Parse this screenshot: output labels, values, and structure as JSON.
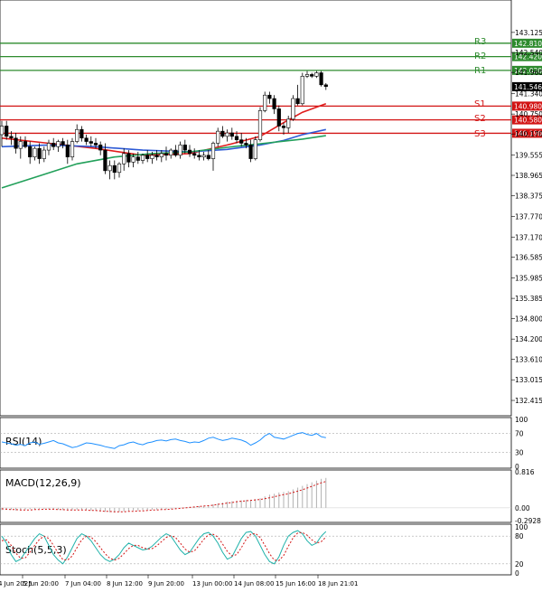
{
  "chart_data": {
    "type": "candlestick",
    "price_axis": {
      "range": [
        132.1,
        143.7
      ],
      "tick_labels": [
        "143.125",
        "142.540",
        "141.960",
        "141.340",
        "140.750",
        "140.170",
        "139.555",
        "138.965",
        "138.375",
        "137.770",
        "137.170",
        "136.585",
        "135.985",
        "135.385",
        "134.800",
        "134.200",
        "133.610",
        "133.015",
        "132.415"
      ],
      "current_price": "141.546"
    },
    "time_axis": {
      "tick_labels": [
        "4 Jun 2025",
        "5 Jun 20:00",
        "7 Jun 04:00",
        "8 Jun 12:00",
        "9 Jun 20:00",
        "13 Jun 00:00",
        "14 Jun 08:00",
        "15 Jun 16:00",
        "18 Jun 21:01"
      ]
    },
    "levels": [
      {
        "name": "",
        "value": 142.81,
        "label": "142.810",
        "color": "#2e8b2e"
      },
      {
        "name": "R3",
        "value": 142.42,
        "label": "142.420",
        "color": "#2e8b2e"
      },
      {
        "name": "R2",
        "value": 142.02,
        "label": "142.020",
        "color": "#2e8b2e"
      },
      {
        "name": "R1",
        "value": null,
        "label": "",
        "color": "#2e8b2e"
      },
      {
        "name": "S1",
        "value": 140.98,
        "label": "140.980",
        "color": "#d21414"
      },
      {
        "name": "S2",
        "value": 140.58,
        "label": "140.580",
        "color": "#d21414"
      },
      {
        "name": "S3",
        "value": 140.19,
        "label": "140.190",
        "color": "#d21414"
      }
    ],
    "candles": [
      {
        "o": 140.15,
        "h": 140.55,
        "l": 139.8,
        "c": 140.4
      },
      {
        "o": 140.4,
        "h": 140.55,
        "l": 140.0,
        "c": 140.1
      },
      {
        "o": 140.1,
        "h": 140.25,
        "l": 139.85,
        "c": 140.05
      },
      {
        "o": 140.05,
        "h": 140.2,
        "l": 139.6,
        "c": 139.75
      },
      {
        "o": 139.75,
        "h": 140.1,
        "l": 139.45,
        "c": 139.95
      },
      {
        "o": 139.95,
        "h": 140.1,
        "l": 139.75,
        "c": 139.8
      },
      {
        "o": 139.8,
        "h": 139.95,
        "l": 139.3,
        "c": 139.5
      },
      {
        "o": 139.5,
        "h": 139.8,
        "l": 139.4,
        "c": 139.75
      },
      {
        "o": 139.75,
        "h": 139.9,
        "l": 139.3,
        "c": 139.45
      },
      {
        "o": 139.45,
        "h": 139.8,
        "l": 139.35,
        "c": 139.7
      },
      {
        "o": 139.7,
        "h": 140.0,
        "l": 139.55,
        "c": 139.9
      },
      {
        "o": 139.9,
        "h": 140.05,
        "l": 139.7,
        "c": 139.8
      },
      {
        "o": 139.8,
        "h": 140.0,
        "l": 139.65,
        "c": 139.95
      },
      {
        "o": 139.95,
        "h": 140.05,
        "l": 139.75,
        "c": 139.85
      },
      {
        "o": 139.85,
        "h": 140.0,
        "l": 139.3,
        "c": 139.5
      },
      {
        "o": 139.5,
        "h": 140.05,
        "l": 139.4,
        "c": 139.95
      },
      {
        "o": 139.95,
        "h": 140.45,
        "l": 139.9,
        "c": 140.3
      },
      {
        "o": 140.3,
        "h": 140.4,
        "l": 139.95,
        "c": 140.05
      },
      {
        "o": 140.05,
        "h": 140.15,
        "l": 139.85,
        "c": 139.95
      },
      {
        "o": 139.95,
        "h": 140.1,
        "l": 139.8,
        "c": 139.9
      },
      {
        "o": 139.9,
        "h": 140.05,
        "l": 139.75,
        "c": 139.85
      },
      {
        "o": 139.85,
        "h": 139.95,
        "l": 139.55,
        "c": 139.7
      },
      {
        "o": 139.7,
        "h": 139.9,
        "l": 139.0,
        "c": 139.1
      },
      {
        "o": 139.1,
        "h": 139.4,
        "l": 138.85,
        "c": 139.25
      },
      {
        "o": 139.25,
        "h": 139.4,
        "l": 138.85,
        "c": 139.05
      },
      {
        "o": 139.05,
        "h": 139.35,
        "l": 138.9,
        "c": 139.3
      },
      {
        "o": 139.3,
        "h": 139.75,
        "l": 139.1,
        "c": 139.6
      },
      {
        "o": 139.6,
        "h": 139.7,
        "l": 139.2,
        "c": 139.35
      },
      {
        "o": 139.35,
        "h": 139.6,
        "l": 139.2,
        "c": 139.5
      },
      {
        "o": 139.5,
        "h": 139.65,
        "l": 139.3,
        "c": 139.4
      },
      {
        "o": 139.4,
        "h": 139.6,
        "l": 139.3,
        "c": 139.55
      },
      {
        "o": 139.55,
        "h": 139.7,
        "l": 139.35,
        "c": 139.45
      },
      {
        "o": 139.45,
        "h": 139.65,
        "l": 139.3,
        "c": 139.55
      },
      {
        "o": 139.55,
        "h": 139.7,
        "l": 139.4,
        "c": 139.5
      },
      {
        "o": 139.5,
        "h": 139.7,
        "l": 139.35,
        "c": 139.6
      },
      {
        "o": 139.6,
        "h": 139.8,
        "l": 139.4,
        "c": 139.55
      },
      {
        "o": 139.55,
        "h": 139.75,
        "l": 139.45,
        "c": 139.7
      },
      {
        "o": 139.7,
        "h": 139.85,
        "l": 139.5,
        "c": 139.55
      },
      {
        "o": 139.55,
        "h": 139.95,
        "l": 139.45,
        "c": 139.85
      },
      {
        "o": 139.85,
        "h": 140.0,
        "l": 139.6,
        "c": 139.7
      },
      {
        "o": 139.7,
        "h": 139.85,
        "l": 139.5,
        "c": 139.6
      },
      {
        "o": 139.6,
        "h": 139.75,
        "l": 139.45,
        "c": 139.55
      },
      {
        "o": 139.55,
        "h": 139.7,
        "l": 139.4,
        "c": 139.5
      },
      {
        "o": 139.5,
        "h": 139.65,
        "l": 139.4,
        "c": 139.55
      },
      {
        "o": 139.55,
        "h": 139.7,
        "l": 139.4,
        "c": 139.45
      },
      {
        "o": 139.45,
        "h": 139.95,
        "l": 139.1,
        "c": 139.9
      },
      {
        "o": 139.9,
        "h": 140.35,
        "l": 139.8,
        "c": 140.25
      },
      {
        "o": 140.25,
        "h": 140.4,
        "l": 140.05,
        "c": 140.1
      },
      {
        "o": 140.1,
        "h": 140.3,
        "l": 139.95,
        "c": 140.2
      },
      {
        "o": 140.2,
        "h": 140.35,
        "l": 140.0,
        "c": 140.1
      },
      {
        "o": 140.1,
        "h": 140.25,
        "l": 139.9,
        "c": 140.0
      },
      {
        "o": 140.0,
        "h": 140.2,
        "l": 139.8,
        "c": 139.9
      },
      {
        "o": 139.9,
        "h": 140.05,
        "l": 139.75,
        "c": 139.85
      },
      {
        "o": 139.85,
        "h": 140.0,
        "l": 139.35,
        "c": 139.45
      },
      {
        "o": 139.45,
        "h": 140.1,
        "l": 139.4,
        "c": 140.0
      },
      {
        "o": 140.0,
        "h": 140.95,
        "l": 139.95,
        "c": 140.85
      },
      {
        "o": 140.85,
        "h": 141.4,
        "l": 140.8,
        "c": 141.3
      },
      {
        "o": 141.3,
        "h": 141.4,
        "l": 141.05,
        "c": 141.2
      },
      {
        "o": 141.2,
        "h": 141.3,
        "l": 140.75,
        "c": 140.9
      },
      {
        "o": 140.9,
        "h": 141.0,
        "l": 140.25,
        "c": 140.4
      },
      {
        "o": 140.4,
        "h": 140.5,
        "l": 140.15,
        "c": 140.35
      },
      {
        "o": 140.35,
        "h": 140.7,
        "l": 140.2,
        "c": 140.6
      },
      {
        "o": 140.6,
        "h": 141.3,
        "l": 140.55,
        "c": 141.2
      },
      {
        "o": 141.2,
        "h": 141.6,
        "l": 141.0,
        "c": 141.05
      },
      {
        "o": 141.05,
        "h": 141.95,
        "l": 141.0,
        "c": 141.85
      },
      {
        "o": 141.85,
        "h": 142.0,
        "l": 141.8,
        "c": 141.9
      },
      {
        "o": 141.9,
        "h": 141.95,
        "l": 141.8,
        "c": 141.85
      },
      {
        "o": 141.85,
        "h": 142.0,
        "l": 141.8,
        "c": 141.95
      },
      {
        "o": 141.95,
        "h": 142.0,
        "l": 141.55,
        "c": 141.6
      },
      {
        "o": 141.6,
        "h": 141.65,
        "l": 141.45,
        "c": 141.55
      }
    ],
    "moving_averages": [
      {
        "color": "#e01c1c",
        "values": [
          [
            0,
            140.05
          ],
          [
            10,
            139.9
          ],
          [
            20,
            139.75
          ],
          [
            30,
            139.55
          ],
          [
            40,
            139.6
          ],
          [
            48,
            139.85
          ],
          [
            55,
            140.1
          ],
          [
            60,
            140.5
          ],
          [
            64,
            140.8
          ],
          [
            69,
            141.05
          ]
        ]
      },
      {
        "color": "#2e5bd6",
        "values": [
          [
            0,
            139.8
          ],
          [
            10,
            139.85
          ],
          [
            20,
            139.8
          ],
          [
            30,
            139.7
          ],
          [
            40,
            139.65
          ],
          [
            48,
            139.72
          ],
          [
            55,
            139.85
          ],
          [
            60,
            139.98
          ],
          [
            64,
            140.15
          ],
          [
            69,
            140.3
          ]
        ]
      },
      {
        "color": "#22a05a",
        "values": [
          [
            0,
            138.6
          ],
          [
            8,
            138.95
          ],
          [
            16,
            139.3
          ],
          [
            24,
            139.5
          ],
          [
            32,
            139.6
          ],
          [
            40,
            139.65
          ],
          [
            48,
            139.78
          ],
          [
            56,
            139.9
          ],
          [
            64,
            140.02
          ],
          [
            69,
            140.12
          ]
        ]
      }
    ],
    "rsi": {
      "name": "RSI(14)",
      "range": [
        0,
        100
      ],
      "tick_labels": [
        "100",
        "70",
        "30",
        "0"
      ],
      "levels": [
        70,
        30
      ],
      "values": [
        52,
        50,
        48,
        45,
        47,
        44,
        50,
        52,
        47,
        49,
        52,
        55,
        50,
        48,
        44,
        40,
        42,
        46,
        50,
        49,
        47,
        45,
        42,
        40,
        38,
        44,
        46,
        50,
        52,
        48,
        46,
        50,
        52,
        55,
        56,
        54,
        57,
        58,
        55,
        53,
        50,
        52,
        51,
        55,
        60,
        62,
        58,
        55,
        57,
        60,
        58,
        56,
        52,
        45,
        50,
        56,
        65,
        70,
        62,
        60,
        58,
        62,
        66,
        70,
        72,
        68,
        66,
        70,
        63,
        61
      ]
    },
    "macd": {
      "name": "MACD(12,26,9)",
      "range": [
        -0.29,
        0.82
      ],
      "tick_labels": [
        "0.816",
        "0.00",
        "-0.2928"
      ],
      "histogram": [
        -0.05,
        -0.03,
        -0.04,
        -0.06,
        -0.05,
        -0.04,
        -0.03,
        -0.03,
        -0.02,
        -0.02,
        -0.02,
        -0.03,
        -0.04,
        -0.05,
        -0.06,
        -0.05,
        -0.04,
        -0.04,
        -0.05,
        -0.06,
        -0.07,
        -0.08,
        -0.09,
        -0.1,
        -0.1,
        -0.09,
        -0.08,
        -0.07,
        -0.06,
        -0.06,
        -0.05,
        -0.05,
        -0.04,
        -0.04,
        -0.03,
        -0.03,
        -0.02,
        -0.01,
        0.0,
        0.01,
        0.02,
        0.03,
        0.04,
        0.05,
        0.06,
        0.08,
        0.1,
        0.12,
        0.14,
        0.15,
        0.16,
        0.17,
        0.18,
        0.18,
        0.2,
        0.22,
        0.26,
        0.3,
        0.32,
        0.35,
        0.36,
        0.38,
        0.42,
        0.46,
        0.5,
        0.54,
        0.58,
        0.62,
        0.66,
        0.68
      ],
      "signal": [
        -0.02,
        -0.03,
        -0.04,
        -0.04,
        -0.05,
        -0.05,
        -0.05,
        -0.04,
        -0.04,
        -0.03,
        -0.03,
        -0.03,
        -0.04,
        -0.04,
        -0.05,
        -0.05,
        -0.05,
        -0.05,
        -0.05,
        -0.06,
        -0.06,
        -0.07,
        -0.08,
        -0.08,
        -0.09,
        -0.09,
        -0.09,
        -0.08,
        -0.08,
        -0.07,
        -0.07,
        -0.06,
        -0.05,
        -0.05,
        -0.04,
        -0.04,
        -0.03,
        -0.02,
        -0.01,
        0.0,
        0.01,
        0.02,
        0.03,
        0.04,
        0.05,
        0.06,
        0.08,
        0.09,
        0.11,
        0.12,
        0.14,
        0.15,
        0.16,
        0.17,
        0.18,
        0.19,
        0.21,
        0.23,
        0.25,
        0.28,
        0.3,
        0.32,
        0.35,
        0.38,
        0.41,
        0.45,
        0.49,
        0.53,
        0.57,
        0.6
      ]
    },
    "stoch": {
      "name": "Stoch(5,5,3)",
      "range": [
        0,
        100
      ],
      "tick_labels": [
        "100",
        "80",
        "20",
        "0"
      ],
      "levels": [
        80,
        20
      ],
      "k": [
        80,
        65,
        40,
        25,
        30,
        45,
        60,
        75,
        85,
        80,
        60,
        40,
        28,
        20,
        35,
        55,
        75,
        85,
        80,
        70,
        55,
        40,
        30,
        25,
        30,
        40,
        55,
        65,
        60,
        55,
        50,
        52,
        58,
        68,
        78,
        85,
        80,
        65,
        50,
        40,
        45,
        60,
        75,
        85,
        88,
        80,
        65,
        45,
        30,
        35,
        55,
        75,
        88,
        90,
        80,
        60,
        40,
        25,
        20,
        35,
        60,
        80,
        88,
        92,
        85,
        70,
        60,
        65,
        80,
        90
      ],
      "d": [
        70,
        72,
        60,
        43,
        32,
        33,
        45,
        60,
        73,
        80,
        75,
        60,
        43,
        29,
        28,
        37,
        55,
        72,
        80,
        78,
        68,
        55,
        42,
        32,
        28,
        32,
        42,
        53,
        60,
        60,
        55,
        52,
        53,
        59,
        68,
        77,
        81,
        77,
        65,
        52,
        45,
        48,
        60,
        73,
        83,
        84,
        78,
        63,
        47,
        37,
        40,
        55,
        73,
        84,
        86,
        77,
        60,
        42,
        28,
        27,
        38,
        58,
        76,
        87,
        88,
        82,
        72,
        65,
        68,
        78
      ]
    }
  }
}
